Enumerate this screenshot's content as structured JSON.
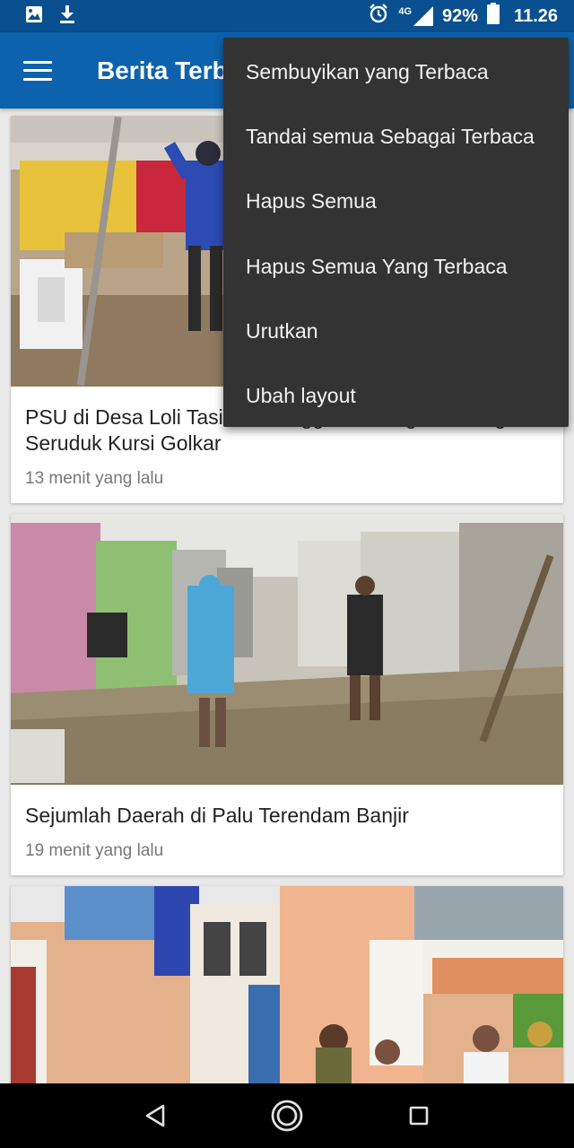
{
  "status_bar": {
    "network_label": "4G",
    "battery": "92%",
    "time": "11.26",
    "icons": [
      "image-icon",
      "download-icon",
      "alarm-icon",
      "signal-icon",
      "battery-icon"
    ]
  },
  "app_bar": {
    "title": "Berita Terbaru",
    "menu_icon": "hamburger-icon",
    "color": "#0d62ad"
  },
  "overflow_menu": {
    "items": [
      {
        "label": "Sembuyikan yang Terbaca"
      },
      {
        "label": "Tandai semua Sebagai Terbaca"
      },
      {
        "label": "Hapus Semua"
      },
      {
        "label": "Hapus Semua Yang Terbaca"
      },
      {
        "label": "Urutkan"
      },
      {
        "label": "Ubah layout"
      }
    ]
  },
  "feed": {
    "articles": [
      {
        "title": "PSU di Desa Loli Tasiburi Donggala, Caleg PAN Sagar Seruduk Kursi Golkar",
        "time": "13 menit yang lalu"
      },
      {
        "title": "Sejumlah Daerah di Palu Terendam Banjir",
        "time": "19 menit yang lalu"
      },
      {
        "title": "",
        "time": ""
      }
    ]
  },
  "nav_bar": {
    "icons": [
      "back-icon",
      "home-icon",
      "recents-icon"
    ]
  }
}
